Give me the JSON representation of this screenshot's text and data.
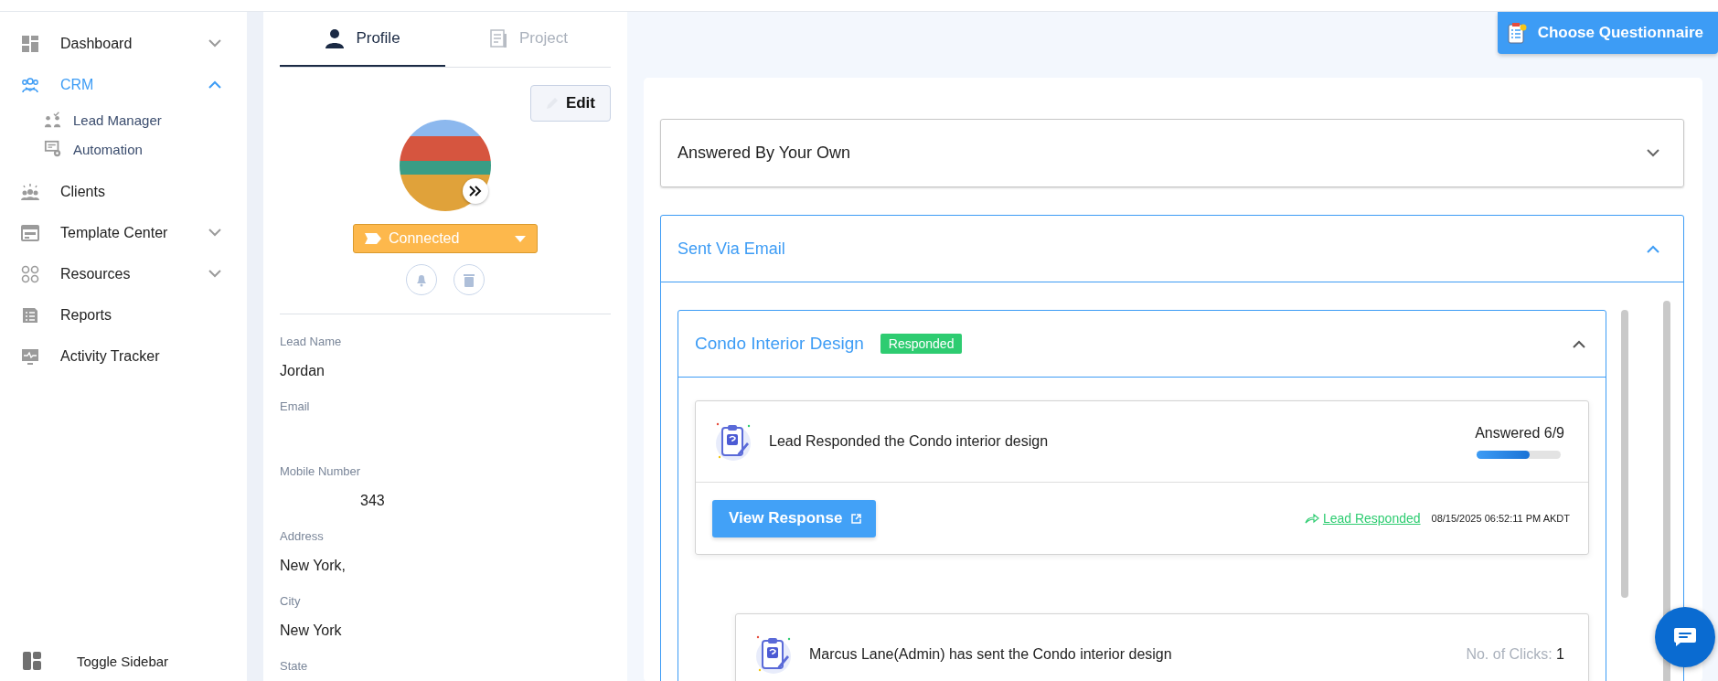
{
  "sidebar": {
    "items": [
      {
        "label": "Dashboard",
        "kind": "menu",
        "selected": false,
        "expanded": false
      },
      {
        "label": "CRM",
        "kind": "menu",
        "selected": true,
        "expanded": true,
        "children": [
          {
            "label": "Lead Manager",
            "selected": false
          },
          {
            "label": "Automation",
            "selected": false
          }
        ]
      },
      {
        "label": "Clients",
        "kind": "link",
        "selected": false
      },
      {
        "label": "Template Center",
        "kind": "menu",
        "selected": false,
        "expanded": false
      },
      {
        "label": "Resources",
        "kind": "menu",
        "selected": false,
        "expanded": false
      },
      {
        "label": "Reports",
        "kind": "link",
        "selected": false
      },
      {
        "label": "Activity Tracker",
        "kind": "link",
        "selected": false
      }
    ],
    "toggle": "Toggle Sidebar"
  },
  "profile": {
    "tabs": [
      {
        "label": "Profile",
        "selected": true
      },
      {
        "label": "Project",
        "selected": false
      }
    ],
    "edit_button": "Edit",
    "status": "Connected",
    "fields": [
      {
        "label": "Lead Name",
        "value": "Jordan"
      },
      {
        "label": "Email"
      },
      {
        "label": "Mobile Number",
        "value": "343"
      },
      {
        "label": "Address",
        "value": "New York,"
      },
      {
        "label": "City",
        "value": "New York"
      },
      {
        "label": "State"
      }
    ]
  },
  "main": {
    "choose_button": "Choose Questionnaire",
    "sections": [
      {
        "title": "Answered By Your Own",
        "expanded": false
      },
      {
        "title": "Sent Via Email",
        "expanded": true,
        "questionnaires": [
          {
            "title": "Condo Interior Design",
            "badge": "Responded",
            "expanded": true,
            "activities": [
              {
                "kind": "response",
                "text": "Lead Responded the Condo interior design",
                "progress_label": "Answered 6/9",
                "level": 0.63,
                "button": "View Response",
                "status": "Lead Responded",
                "timestamp": "08/15/2025 06:52:11 PM AKDT"
              },
              {
                "kind": "sent",
                "text": "Marcus Lane(Admin) has sent the Condo interior design",
                "clicks_label": "No. of Clicks:",
                "clicks": "1"
              }
            ]
          }
        ]
      }
    ]
  }
}
